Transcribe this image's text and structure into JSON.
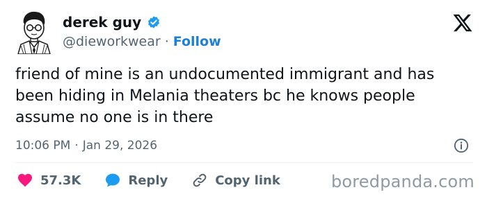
{
  "author": {
    "display_name": "derek guy",
    "handle": "@dieworkwear",
    "separator": "·",
    "follow_label": "Follow",
    "verified_color": "#1d9bf0"
  },
  "tweet": {
    "text": "friend of mine is an undocumented immigrant and has been hiding in Melania theaters bc he knows people assume no one is in there",
    "time": "10:06 PM",
    "date_separator": "·",
    "date": "Jan 29, 2026"
  },
  "actions": {
    "like_count": "57.3K",
    "like_color": "#f91880",
    "reply_label": "Reply",
    "reply_color": "#1d9bf0",
    "copy_link_label": "Copy link"
  },
  "icons": {
    "brand": "x-logo-icon",
    "info": "info-icon",
    "like": "heart-icon",
    "reply": "speech-bubble-icon",
    "copy": "link-icon"
  },
  "watermark": "boredpanda.com"
}
